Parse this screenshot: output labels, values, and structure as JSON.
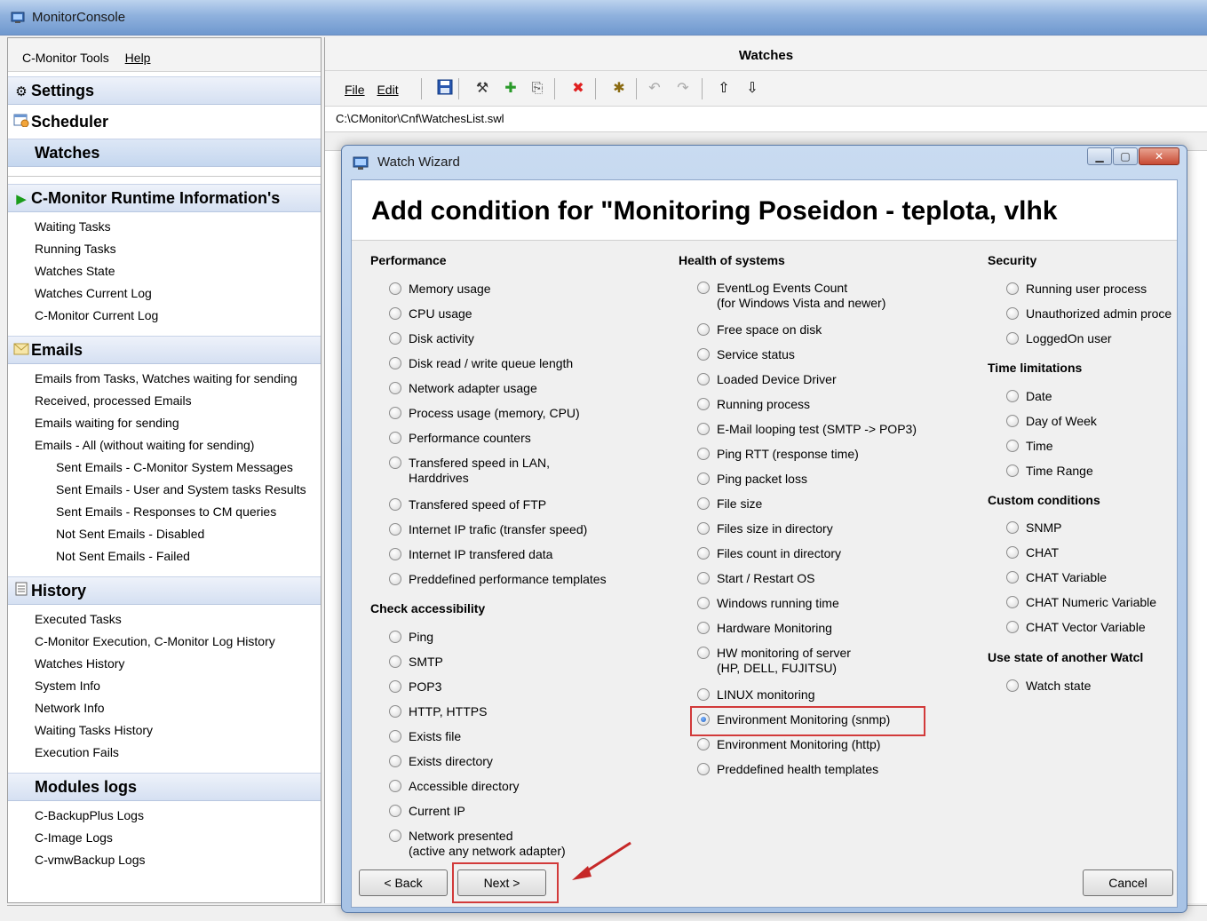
{
  "window": {
    "title": "MonitorConsole"
  },
  "left_menu": {
    "tools": "C-Monitor Tools",
    "help": "Help"
  },
  "nav": {
    "settings": "Settings",
    "scheduler": "Scheduler",
    "watches": "Watches",
    "runtime": {
      "title": "C-Monitor Runtime Information's",
      "items": [
        "Waiting Tasks",
        "Running Tasks",
        "Watches State",
        "Watches Current Log",
        "C-Monitor Current Log"
      ]
    },
    "emails": {
      "title": "Emails",
      "items": [
        "Emails from Tasks, Watches waiting for sending",
        "Received, processed Emails",
        "Emails waiting for sending",
        "Emails - All (without waiting for sending)"
      ],
      "subitems": [
        "Sent Emails - C-Monitor System Messages",
        "Sent Emails - User and System tasks Results",
        "Sent Emails - Responses to CM queries",
        "Not Sent Emails - Disabled",
        "Not Sent Emails - Failed"
      ]
    },
    "history": {
      "title": "History",
      "items": [
        "Executed Tasks",
        "C-Monitor Execution, C-Monitor Log History",
        "Watches History",
        "System Info",
        "Network Info",
        "Waiting Tasks History",
        "Execution Fails"
      ]
    },
    "modules": {
      "title": "Modules logs",
      "items": [
        "C-BackupPlus Logs",
        "C-Image Logs",
        "C-vmwBackup Logs"
      ]
    }
  },
  "right": {
    "title": "Watches",
    "menu_file": "File",
    "menu_edit": "Edit",
    "path": "C:\\CMonitor\\Cnf\\WatchesList.swl"
  },
  "dialog": {
    "title": "Watch Wizard",
    "heading": "Add condition for \"Monitoring Poseidon - teplota, vlhk",
    "back": "< Back",
    "next": "Next >",
    "cancel": "Cancel",
    "performance": {
      "title": "Performance",
      "options": [
        "Memory usage",
        "CPU usage",
        "Disk activity",
        "Disk read / write queue length",
        "Network adapter usage",
        "Process usage (memory, CPU)",
        "Performance counters",
        "Transfered speed in LAN,\nHarddrives",
        "Transfered speed of FTP",
        "Internet IP trafic (transfer speed)",
        "Internet IP transfered data",
        "Preddefined performance templates"
      ]
    },
    "accessibility": {
      "title": "Check accessibility",
      "options": [
        "Ping",
        "SMTP",
        "POP3",
        "HTTP, HTTPS",
        "Exists file",
        "Exists directory",
        "Accessible directory",
        "Current IP",
        "Network presented\n(active any network adapter)"
      ]
    },
    "health": {
      "title": "Health of systems",
      "options": [
        "EventLog Events Count\n(for Windows Vista and newer)",
        "Free space on disk",
        "Service status",
        "Loaded Device Driver",
        "Running process",
        "E-Mail looping test (SMTP -> POP3)",
        "Ping RTT (response time)",
        "Ping packet loss",
        "File size",
        "Files size in directory",
        "Files count in directory",
        "Start / Restart OS",
        "Windows running time",
        "Hardware Monitoring",
        "HW monitoring of server\n(HP, DELL, FUJITSU)",
        "LINUX monitoring",
        "Environment Monitoring (snmp)",
        "Environment Monitoring (http)",
        "Preddefined health templates"
      ],
      "selected": "Environment Monitoring (snmp)"
    },
    "security": {
      "title": "Security",
      "options": [
        "Running user process",
        "Unauthorized admin proce",
        "LoggedOn user"
      ]
    },
    "time": {
      "title": "Time limitations",
      "options": [
        "Date",
        "Day of Week",
        "Time",
        "Time Range"
      ]
    },
    "custom": {
      "title": "Custom conditions",
      "options": [
        "SNMP",
        "CHAT",
        "CHAT Variable",
        "CHAT Numeric Variable",
        "CHAT Vector Variable"
      ]
    },
    "another": {
      "title": "Use state of another Watcl",
      "options": [
        "Watch state"
      ]
    }
  }
}
